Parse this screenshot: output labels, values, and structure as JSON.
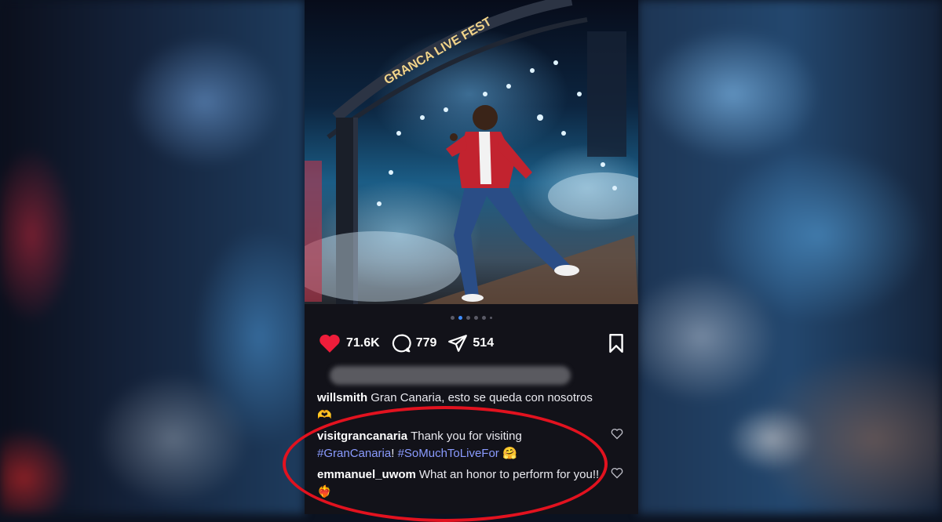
{
  "post": {
    "stage_banner": "GRANCA LIVE FEST",
    "carousel": {
      "total": 6,
      "active": 1
    },
    "likes": "71.6K",
    "comments": "779",
    "shares": "514",
    "caption": {
      "user": "willsmith",
      "text": "Gran Canaria, esto se queda con nosotros",
      "emoji": "🫶"
    },
    "comments_list": [
      {
        "user": "visitgrancanaria",
        "text_before": "Thank you for visiting",
        "tag1": "#GranCanaria",
        "mid": "!",
        "tag2": "#SoMuchToLiveFor",
        "emoji": "🤗"
      },
      {
        "user": "emmanuel_uwom",
        "text": "What an honor to perform for you!!",
        "emoji": "❤️‍🔥"
      }
    ]
  },
  "colors": {
    "background": "#121219",
    "like_red": "#ee1d3a",
    "hashtag": "#8a9bff",
    "highlight_ellipse": "#e2121f"
  }
}
